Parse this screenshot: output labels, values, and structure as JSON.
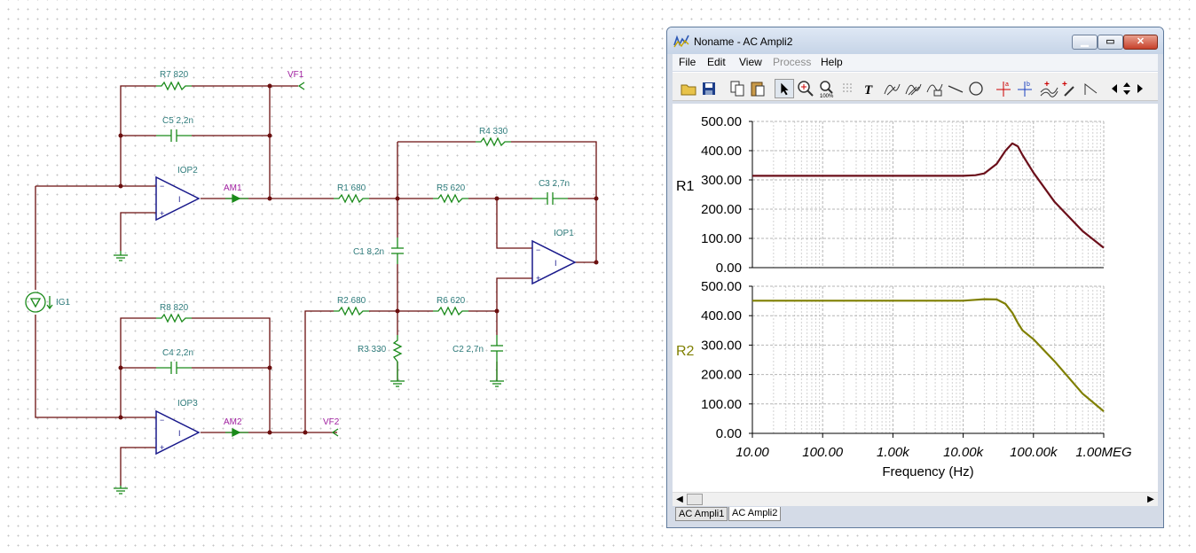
{
  "schematic": {
    "labels": {
      "r7": "R7 820",
      "c5": "C5 2,2n",
      "iop2": "IOP2",
      "am1": "AM1",
      "vf1": "VF1",
      "r1": "R1 680",
      "r4": "R4 330",
      "r5": "R5 620",
      "c3": "C3 2,7n",
      "iop1": "IOP1",
      "c1": "C1 8,2n",
      "ig1": "IG1",
      "r8": "R8 820",
      "c4": "C4 2,2n",
      "iop3": "IOP3",
      "am2": "AM2",
      "vf2": "VF2",
      "r2": "R2 680",
      "r6": "R6 620",
      "r3": "R3 330",
      "c2": "C2 2,7n"
    },
    "colors": {
      "wire": "#6b0f0f",
      "component": "#1a8a1a",
      "opamp": "#1a1a8c",
      "label": "#2f7c7c",
      "net_label": "#a020a0"
    }
  },
  "window": {
    "title": "Noname - AC Ampli2",
    "icon": "tina-app-icon",
    "menus": [
      {
        "label": "File",
        "enabled": true
      },
      {
        "label": "Edit",
        "enabled": true
      },
      {
        "label": "View",
        "enabled": true
      },
      {
        "label": "Process",
        "enabled": false
      },
      {
        "label": "Help",
        "enabled": true
      }
    ],
    "toolbar_icons": [
      "open-folder-icon",
      "save-icon",
      "copy-icon",
      "paste-icon",
      "pointer-icon",
      "zoom-in-icon",
      "zoom-100-icon",
      "grid-icon",
      "text-tool-icon",
      "curve-label-icon",
      "curve-label-2-icon",
      "curve-label-3-icon",
      "line-tool-icon",
      "circle-tool-icon",
      "cursor-a-icon",
      "cursor-b-icon",
      "add-curve-icon",
      "add-marker-icon",
      "slope-icon",
      "scroll-left-icon",
      "scroll-updown-icon",
      "scroll-right-icon"
    ],
    "tabs": [
      {
        "label": "AC Ampli1",
        "active": false
      },
      {
        "label": "AC Ampli2",
        "active": true
      }
    ]
  },
  "chart_data": {
    "type": "line",
    "xscale": "log",
    "xlim": [
      10,
      1000000
    ],
    "x_tick_labels": [
      "10.00",
      "100.00",
      "1.00k",
      "10.00k",
      "100.00k",
      "1.00MEG"
    ],
    "xlabel": "Frequency (Hz)",
    "grid": true,
    "panels": [
      {
        "ylabel": "R1",
        "color": "#6b0f1a",
        "ylim": [
          0,
          500
        ],
        "y_tick_labels": [
          "500.00",
          "400.00",
          "300.00",
          "200.00",
          "100.00",
          "0.00"
        ],
        "x": [
          10,
          100,
          1000,
          10000,
          15000,
          20000,
          30000,
          40000,
          50000,
          60000,
          70000,
          100000,
          200000,
          500000,
          1000000
        ],
        "y": [
          314,
          314,
          314,
          314,
          316,
          322,
          355,
          400,
          425,
          415,
          385,
          325,
          225,
          125,
          68
        ]
      },
      {
        "ylabel": "R2",
        "color": "#7f7f00",
        "ylim": [
          0,
          500
        ],
        "y_tick_labels": [
          "500.00",
          "400.00",
          "300.00",
          "200.00",
          "100.00",
          "0.00"
        ],
        "x": [
          10,
          100,
          1000,
          10000,
          15000,
          20000,
          30000,
          40000,
          50000,
          60000,
          70000,
          100000,
          200000,
          500000,
          1000000
        ],
        "y": [
          451,
          451,
          451,
          451,
          454,
          456,
          455,
          440,
          410,
          375,
          350,
          320,
          245,
          135,
          75
        ]
      }
    ]
  }
}
